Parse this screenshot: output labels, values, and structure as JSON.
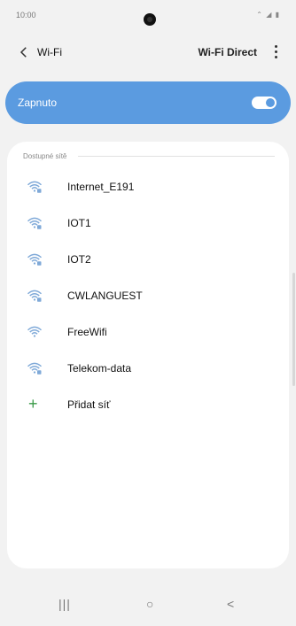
{
  "status": {
    "time": "10:00",
    "icons": "⌃ ◢ ▮"
  },
  "header": {
    "title": "Wi-Fi",
    "wifi_direct_label": "Wi-Fi Direct"
  },
  "wifi_toggle": {
    "label": "Zapnuto",
    "enabled": true
  },
  "networks": {
    "section_title": "Dostupné sítě",
    "items": [
      {
        "name": "Internet_E191",
        "icon": "wifi-lock-icon",
        "locked": true
      },
      {
        "name": "IOT1",
        "icon": "wifi-lock-icon",
        "locked": true
      },
      {
        "name": "IOT2",
        "icon": "wifi-lock-icon",
        "locked": true
      },
      {
        "name": "CWLANGUEST",
        "icon": "wifi-lock-icon",
        "locked": true
      },
      {
        "name": "FreeWifi",
        "icon": "wifi-icon",
        "locked": false
      },
      {
        "name": "Telekom-data",
        "icon": "wifi-lock-icon",
        "locked": true
      }
    ],
    "add_label": "Přidat síť"
  },
  "navbar": {
    "recent": "|||",
    "home": "○",
    "back": "<"
  },
  "colors": {
    "accent": "#5b9be0",
    "add_green": "#3a9a48",
    "wifi_icon": "#7fa9d8"
  }
}
